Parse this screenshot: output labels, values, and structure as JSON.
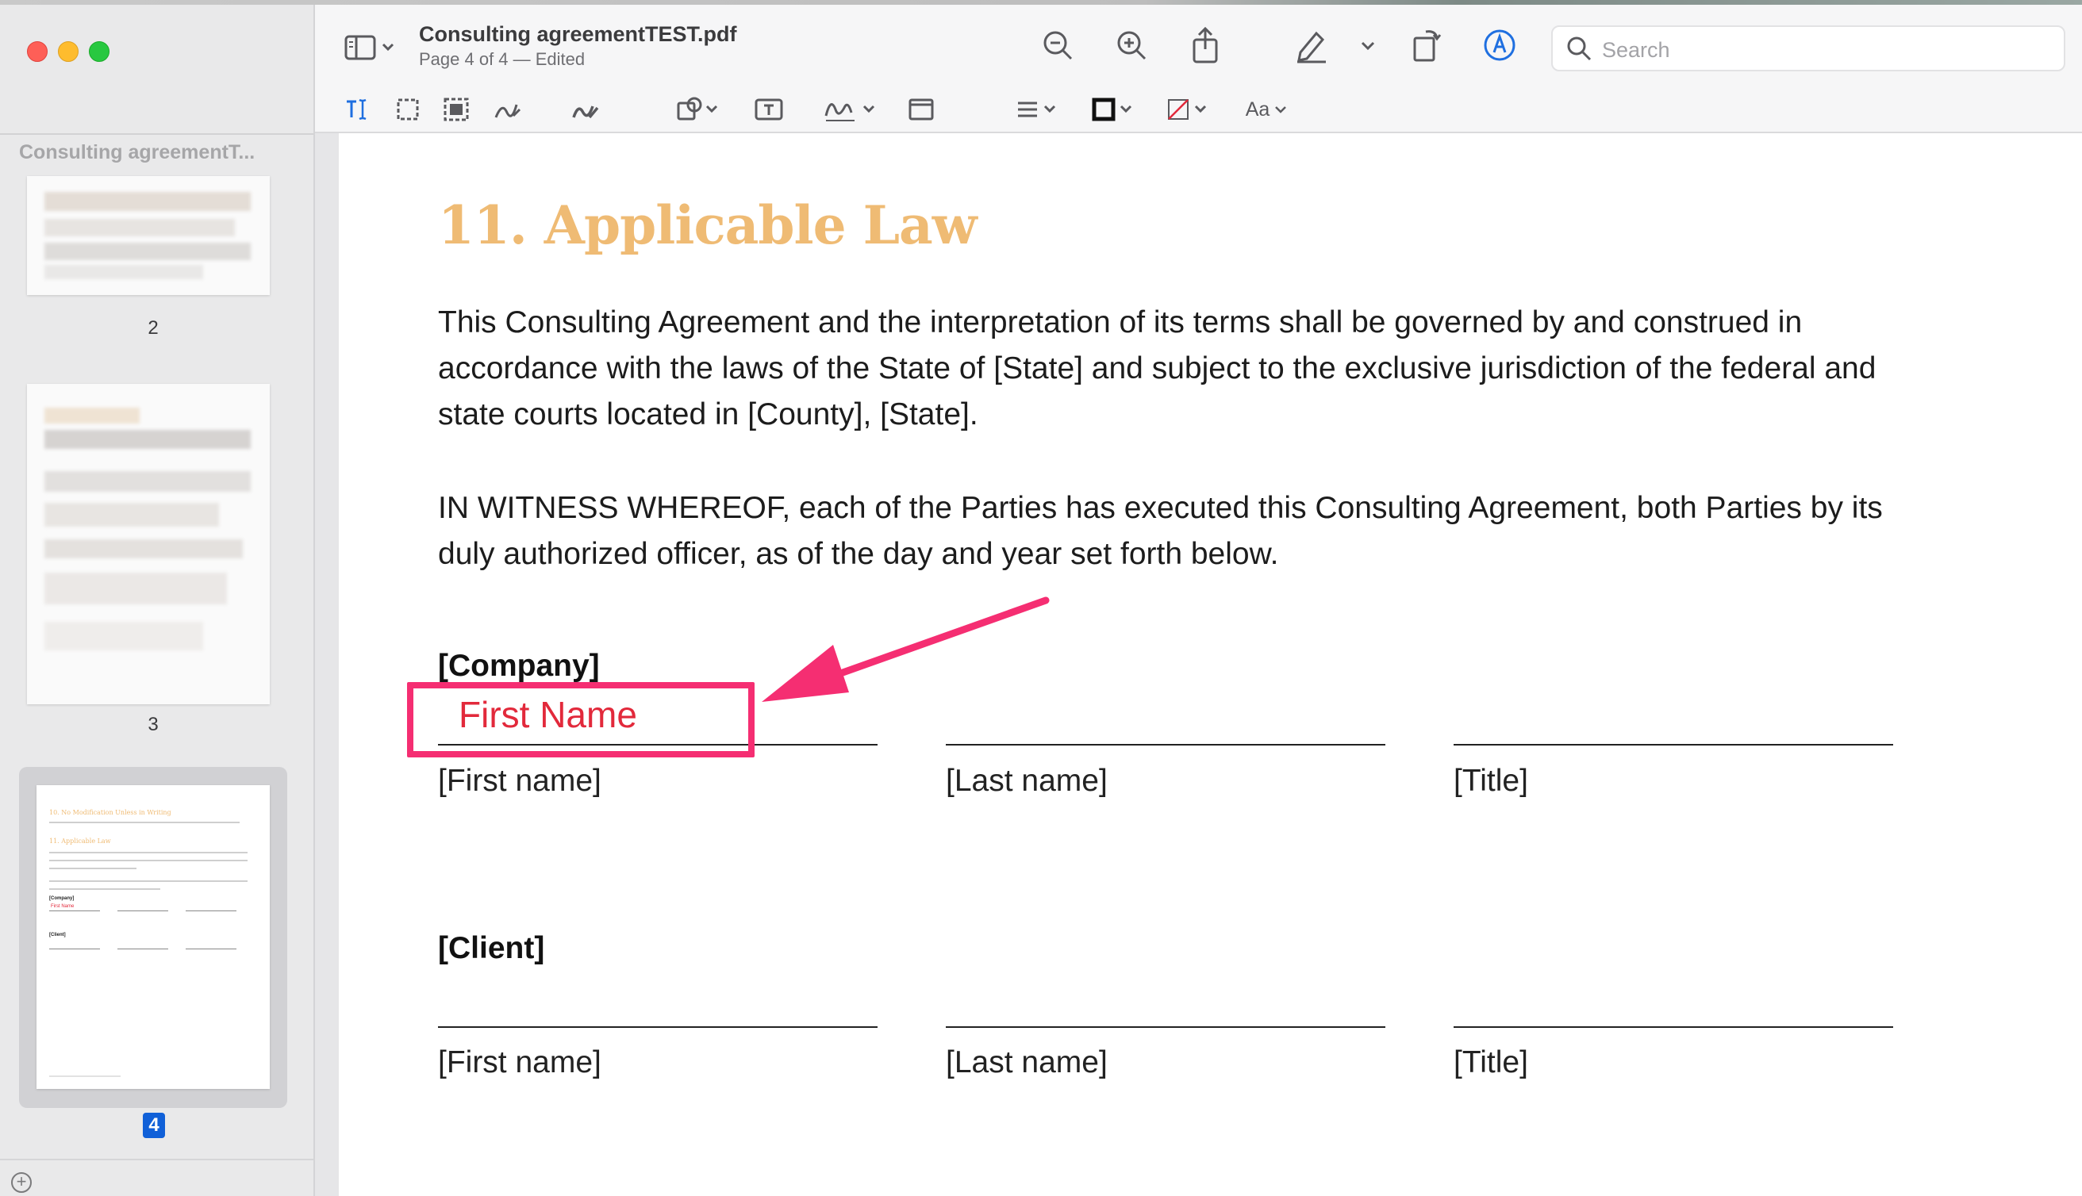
{
  "window": {
    "title": "Consulting agreementTEST.pdf",
    "subtitle": "Page 4 of 4 — Edited"
  },
  "toolbar": {
    "search_placeholder": "Search",
    "markup_font_label": "Aa"
  },
  "sidebar": {
    "header": "Consulting agreementT...",
    "pages": [
      {
        "number": "2"
      },
      {
        "number": "3"
      },
      {
        "number": "4",
        "selected": true
      }
    ],
    "thumb4": {
      "heading1": "10. No Modification Unless in Writing",
      "heading2": "11. Applicable Law",
      "annotation": "First Name",
      "company": "[Company]",
      "client": "[Client]"
    }
  },
  "document": {
    "heading": "11. Applicable Law",
    "paragraph1": "This Consulting Agreement and the interpretation of its terms shall be governed by and construed in accordance with the laws of the State of [State] and subject to the exclusive jurisdiction of the federal and state courts located in [County], [State].",
    "paragraph2": "IN WITNESS WHEREOF, each of the Parties has executed this Consulting Agreement, both Parties by its duly authorized officer, as of the day and year set forth below.",
    "company_label": "[Company]",
    "client_label": "[Client]",
    "company_fields": [
      "[First name]",
      "[Last name]",
      "[Title]"
    ],
    "client_fields": [
      "[First name]",
      "[Last name]",
      "[Title]"
    ],
    "annotation_text": "First Name"
  },
  "colors": {
    "heading": "#efbb74",
    "callout": "#f52e72",
    "annotation_text": "#e2293b",
    "page_badge": "#1060d8"
  }
}
